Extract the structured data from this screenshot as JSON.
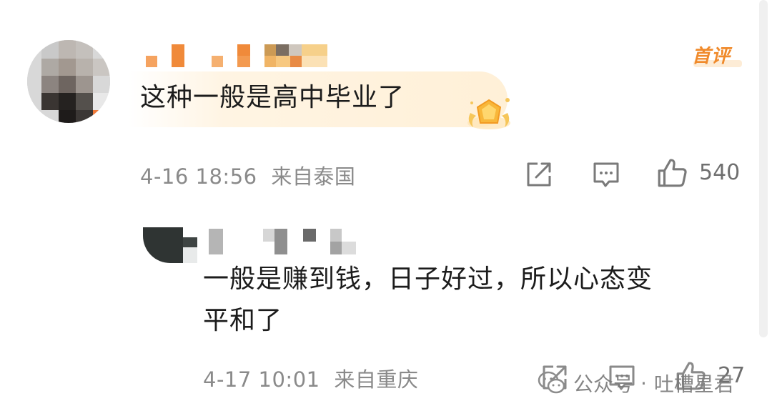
{
  "badge": {
    "first_comment": "首评"
  },
  "comment": {
    "text": "这种一般是高中毕业了",
    "date": "4-16 18:56",
    "location": "来自泰国",
    "likes": "540"
  },
  "reply": {
    "text_line1": "一般是赚到钱，日子好过，所以心态变",
    "text_line2": "平和了",
    "date": "4-17 10:01",
    "location": "来自重庆",
    "likes": "27"
  },
  "watermark": {
    "channel": "公众号",
    "separator": "·",
    "name": "吐槽星君"
  },
  "icons": {
    "share": "share-icon",
    "comment": "comment-icon",
    "like": "thumbs-up-icon",
    "medal": "medal-icon"
  },
  "colors": {
    "accent": "#f08a2b",
    "meta_text": "#8a8a8a",
    "body_text": "#1c1c1c"
  }
}
